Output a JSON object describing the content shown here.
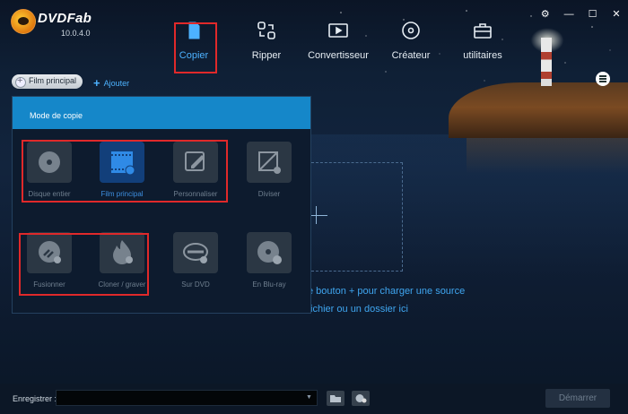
{
  "app": {
    "name": "DVDFab",
    "version": "10.0.4.0"
  },
  "window_controls": {
    "settings": "⚙",
    "minimize": "—",
    "maximize": "☐",
    "close": "✕"
  },
  "nav": [
    {
      "id": "copier",
      "label": "Copier",
      "icon": "copy-doc-icon",
      "active": true
    },
    {
      "id": "ripper",
      "label": "Ripper",
      "icon": "ripper-icon",
      "active": false
    },
    {
      "id": "convertisseur",
      "label": "Convertisseur",
      "icon": "film-convert-icon",
      "active": false
    },
    {
      "id": "createur",
      "label": "Créateur",
      "icon": "disc-create-icon",
      "active": false
    },
    {
      "id": "utilitaires",
      "label": "utilitaires",
      "icon": "toolbox-icon",
      "active": false
    }
  ],
  "mode_selector": {
    "label": "Film principal",
    "add_label": "Ajouter"
  },
  "copy_modes": {
    "title": "Mode de copie",
    "tiles": [
      {
        "label": "Disque entier",
        "icon": "disc-icon",
        "active": false
      },
      {
        "label": "Film principal",
        "icon": "film-icon",
        "active": true
      },
      {
        "label": "Personnaliser",
        "icon": "edit-icon",
        "active": false
      },
      {
        "label": "Diviser",
        "icon": "split-icon",
        "active": false
      },
      {
        "label": "Fusionner",
        "icon": "merge-icon",
        "active": false
      },
      {
        "label": "Cloner / graver",
        "icon": "flame-icon",
        "active": false
      },
      {
        "label": "Sur DVD",
        "icon": "bluray-icon",
        "active": false
      },
      {
        "label": "En Blu-ray",
        "icon": "disc-convert-icon",
        "active": false
      }
    ]
  },
  "source_hint": {
    "line1": "e bouton + pour charger une source",
    "line2": "fichier ou un dossier ici"
  },
  "bottom": {
    "save_label": "Enregistrer :",
    "save_value": "",
    "start_label": "Démarrer"
  },
  "colors": {
    "accent": "#4db2ff",
    "panel_header": "#1587c9",
    "highlight_box": "#e0292a"
  }
}
